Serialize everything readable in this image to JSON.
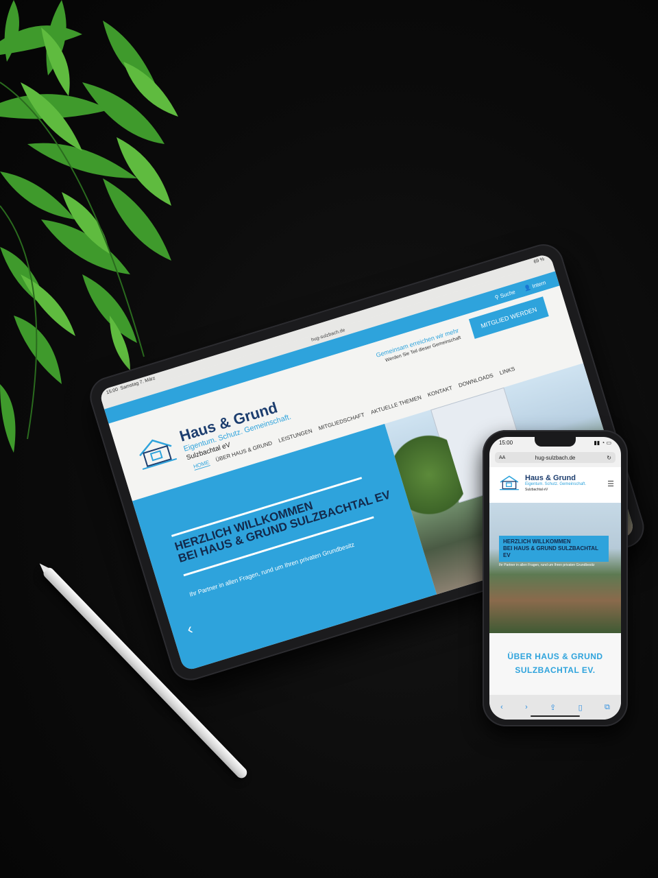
{
  "colors": {
    "brand_blue": "#2ea3dc",
    "navy": "#1c3d6e",
    "background": "#0a0a0a"
  },
  "tablet": {
    "status": {
      "time": "15:00",
      "date": "Samstag 7. März",
      "battery": "69 %"
    },
    "url": "hug-sulzbach.de",
    "topbar": {
      "search": "Suche",
      "intern": "Intern"
    },
    "brand": {
      "name": "Haus & Grund",
      "tagline": "Eigentum. Schutz. Gemeinschaft.",
      "location": "Sulzbachtal eV"
    },
    "slogan": {
      "main": "Gemeinsam erreichen wir mehr",
      "sub": "Werden Sie Teil dieser Gemeinschaft"
    },
    "member_button": "MITGLIED WERDEN",
    "nav": [
      "HOME",
      "ÜBER HAUS & GRUND",
      "LEISTUNGEN",
      "MITGLIEDSCHAFT",
      "AKTUELLE THEMEN",
      "KONTAKT",
      "DOWNLOADS",
      "LINKS"
    ],
    "hero": {
      "title_line1": "HERZLICH WILLKOMMEN",
      "title_line2": "BEI HAUS & GRUND SULZBACHTAL EV",
      "subtitle": "Ihr Partner in allen Fragen, rund um Ihren privaten Grundbesitz",
      "prev_arrow": "‹"
    }
  },
  "phone": {
    "status": {
      "time": "15:00"
    },
    "url": "hug-sulzbach.de",
    "url_aa": "AA",
    "brand": {
      "name": "Haus & Grund",
      "tagline": "Eigentum. Schutz. Gemeinschaft.",
      "location": "Sulzbachtal eV"
    },
    "hero": {
      "title_line1": "HERZLICH WILLKOMMEN",
      "title_line2": "BEI HAUS & GRUND SULZBACHTAL EV",
      "subtitle": "Ihr Partner in allen Fragen, rund um Ihren privaten Grundbesitz"
    },
    "about": {
      "line1": "ÜBER HAUS & GRUND",
      "line2": "SULZBACHTAL EV."
    },
    "toolbar": [
      "back-icon",
      "forward-icon",
      "share-icon",
      "bookmarks-icon",
      "tabs-icon"
    ]
  }
}
